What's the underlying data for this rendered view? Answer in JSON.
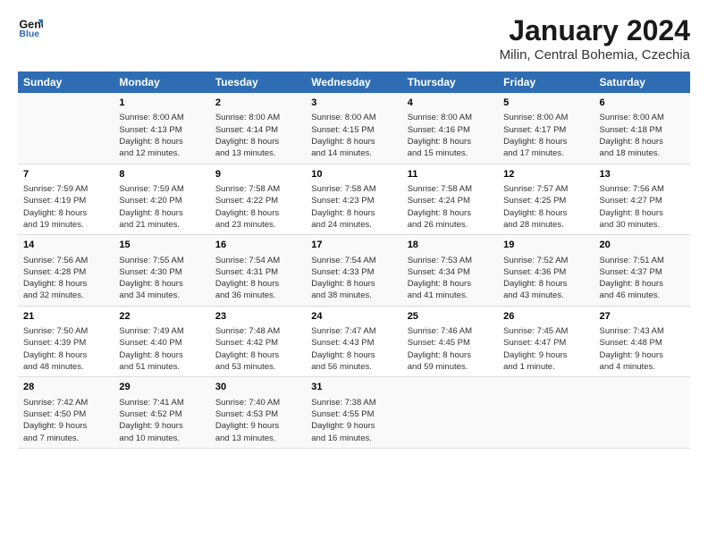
{
  "header": {
    "logo_line1": "General",
    "logo_line2": "Blue",
    "month": "January 2024",
    "location": "Milin, Central Bohemia, Czechia"
  },
  "weekdays": [
    "Sunday",
    "Monday",
    "Tuesday",
    "Wednesday",
    "Thursday",
    "Friday",
    "Saturday"
  ],
  "weeks": [
    [
      {
        "day": "",
        "info": ""
      },
      {
        "day": "1",
        "info": "Sunrise: 8:00 AM\nSunset: 4:13 PM\nDaylight: 8 hours\nand 12 minutes."
      },
      {
        "day": "2",
        "info": "Sunrise: 8:00 AM\nSunset: 4:14 PM\nDaylight: 8 hours\nand 13 minutes."
      },
      {
        "day": "3",
        "info": "Sunrise: 8:00 AM\nSunset: 4:15 PM\nDaylight: 8 hours\nand 14 minutes."
      },
      {
        "day": "4",
        "info": "Sunrise: 8:00 AM\nSunset: 4:16 PM\nDaylight: 8 hours\nand 15 minutes."
      },
      {
        "day": "5",
        "info": "Sunrise: 8:00 AM\nSunset: 4:17 PM\nDaylight: 8 hours\nand 17 minutes."
      },
      {
        "day": "6",
        "info": "Sunrise: 8:00 AM\nSunset: 4:18 PM\nDaylight: 8 hours\nand 18 minutes."
      }
    ],
    [
      {
        "day": "7",
        "info": "Sunrise: 7:59 AM\nSunset: 4:19 PM\nDaylight: 8 hours\nand 19 minutes."
      },
      {
        "day": "8",
        "info": "Sunrise: 7:59 AM\nSunset: 4:20 PM\nDaylight: 8 hours\nand 21 minutes."
      },
      {
        "day": "9",
        "info": "Sunrise: 7:58 AM\nSunset: 4:22 PM\nDaylight: 8 hours\nand 23 minutes."
      },
      {
        "day": "10",
        "info": "Sunrise: 7:58 AM\nSunset: 4:23 PM\nDaylight: 8 hours\nand 24 minutes."
      },
      {
        "day": "11",
        "info": "Sunrise: 7:58 AM\nSunset: 4:24 PM\nDaylight: 8 hours\nand 26 minutes."
      },
      {
        "day": "12",
        "info": "Sunrise: 7:57 AM\nSunset: 4:25 PM\nDaylight: 8 hours\nand 28 minutes."
      },
      {
        "day": "13",
        "info": "Sunrise: 7:56 AM\nSunset: 4:27 PM\nDaylight: 8 hours\nand 30 minutes."
      }
    ],
    [
      {
        "day": "14",
        "info": "Sunrise: 7:56 AM\nSunset: 4:28 PM\nDaylight: 8 hours\nand 32 minutes."
      },
      {
        "day": "15",
        "info": "Sunrise: 7:55 AM\nSunset: 4:30 PM\nDaylight: 8 hours\nand 34 minutes."
      },
      {
        "day": "16",
        "info": "Sunrise: 7:54 AM\nSunset: 4:31 PM\nDaylight: 8 hours\nand 36 minutes."
      },
      {
        "day": "17",
        "info": "Sunrise: 7:54 AM\nSunset: 4:33 PM\nDaylight: 8 hours\nand 38 minutes."
      },
      {
        "day": "18",
        "info": "Sunrise: 7:53 AM\nSunset: 4:34 PM\nDaylight: 8 hours\nand 41 minutes."
      },
      {
        "day": "19",
        "info": "Sunrise: 7:52 AM\nSunset: 4:36 PM\nDaylight: 8 hours\nand 43 minutes."
      },
      {
        "day": "20",
        "info": "Sunrise: 7:51 AM\nSunset: 4:37 PM\nDaylight: 8 hours\nand 46 minutes."
      }
    ],
    [
      {
        "day": "21",
        "info": "Sunrise: 7:50 AM\nSunset: 4:39 PM\nDaylight: 8 hours\nand 48 minutes."
      },
      {
        "day": "22",
        "info": "Sunrise: 7:49 AM\nSunset: 4:40 PM\nDaylight: 8 hours\nand 51 minutes."
      },
      {
        "day": "23",
        "info": "Sunrise: 7:48 AM\nSunset: 4:42 PM\nDaylight: 8 hours\nand 53 minutes."
      },
      {
        "day": "24",
        "info": "Sunrise: 7:47 AM\nSunset: 4:43 PM\nDaylight: 8 hours\nand 56 minutes."
      },
      {
        "day": "25",
        "info": "Sunrise: 7:46 AM\nSunset: 4:45 PM\nDaylight: 8 hours\nand 59 minutes."
      },
      {
        "day": "26",
        "info": "Sunrise: 7:45 AM\nSunset: 4:47 PM\nDaylight: 9 hours\nand 1 minute."
      },
      {
        "day": "27",
        "info": "Sunrise: 7:43 AM\nSunset: 4:48 PM\nDaylight: 9 hours\nand 4 minutes."
      }
    ],
    [
      {
        "day": "28",
        "info": "Sunrise: 7:42 AM\nSunset: 4:50 PM\nDaylight: 9 hours\nand 7 minutes."
      },
      {
        "day": "29",
        "info": "Sunrise: 7:41 AM\nSunset: 4:52 PM\nDaylight: 9 hours\nand 10 minutes."
      },
      {
        "day": "30",
        "info": "Sunrise: 7:40 AM\nSunset: 4:53 PM\nDaylight: 9 hours\nand 13 minutes."
      },
      {
        "day": "31",
        "info": "Sunrise: 7:38 AM\nSunset: 4:55 PM\nDaylight: 9 hours\nand 16 minutes."
      },
      {
        "day": "",
        "info": ""
      },
      {
        "day": "",
        "info": ""
      },
      {
        "day": "",
        "info": ""
      }
    ]
  ]
}
